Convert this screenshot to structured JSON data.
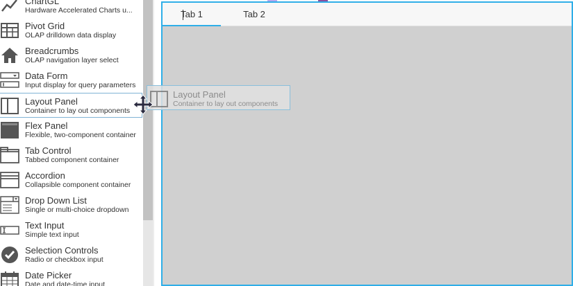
{
  "palette": {
    "items": [
      {
        "title": "ChartGL",
        "desc": "Hardware Accelerated Charts u...",
        "icon": "line-chart-icon"
      },
      {
        "title": "Pivot Grid",
        "desc": "OLAP drilldown data display",
        "icon": "pivot-grid-icon"
      },
      {
        "title": "Breadcrumbs",
        "desc": "OLAP navigation layer select",
        "icon": "house-icon"
      },
      {
        "title": "Data Form",
        "desc": "Input display for query parameters",
        "icon": "form-icon"
      },
      {
        "title": "Layout Panel",
        "desc": "Container to lay out components",
        "icon": "layout-panel-icon"
      },
      {
        "title": "Flex Panel",
        "desc": "Flexible, two-component container",
        "icon": "flex-panel-icon"
      },
      {
        "title": "Tab Control",
        "desc": "Tabbed component container",
        "icon": "tab-control-icon"
      },
      {
        "title": "Accordion",
        "desc": "Collapsible component container",
        "icon": "accordion-icon"
      },
      {
        "title": "Drop Down List",
        "desc": "Single or multi-choice dropdown",
        "icon": "dropdown-icon"
      },
      {
        "title": "Text Input",
        "desc": "Simple text input",
        "icon": "text-input-icon"
      },
      {
        "title": "Selection Controls",
        "desc": "Radio or checkbox input",
        "icon": "checkmark-icon"
      },
      {
        "title": "Date Picker",
        "desc": "Date and date-time input",
        "icon": "calendar-icon"
      }
    ]
  },
  "tabs": [
    {
      "label": "Tab 1",
      "selected": true
    },
    {
      "label": "Tab 2",
      "selected": false
    }
  ],
  "drag": {
    "title": "Layout Panel",
    "desc": "Container to lay out components"
  },
  "colors": {
    "accent": "#2eaee8",
    "canvas": "#d0d0d0",
    "text": "#333333",
    "icon": "#555555"
  }
}
